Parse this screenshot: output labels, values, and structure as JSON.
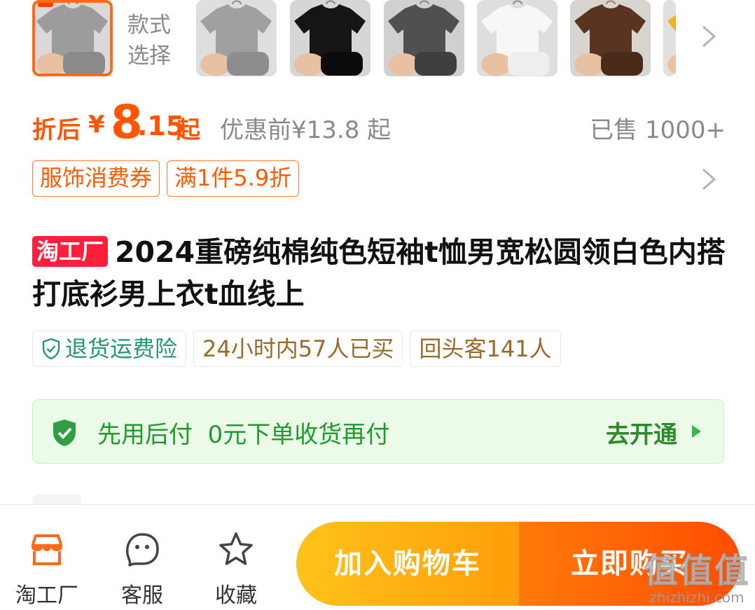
{
  "styles": {
    "label": "款式\n选择",
    "thumbnails": [
      {
        "color": "#9c9c9c",
        "fold": "#8a8a8a",
        "bg": "#d9d9d9",
        "selected": true
      },
      {
        "color": "#a0a0a0",
        "fold": "#8d8d8d",
        "bg": "#dedede",
        "selected": false
      },
      {
        "color": "#151515",
        "fold": "#0c0c0c",
        "bg": "#d6d6d6",
        "selected": false
      },
      {
        "color": "#505050",
        "fold": "#3f3f3f",
        "bg": "#d0d0d0",
        "selected": false
      },
      {
        "color": "#f7f7f7",
        "fold": "#eeeeee",
        "bg": "#dedede",
        "selected": false
      },
      {
        "color": "#5a3420",
        "fold": "#4a2a18",
        "bg": "#d8d4d0",
        "selected": false
      },
      {
        "color": "#f2b21c",
        "fold": "#e5a010",
        "bg": "#e0e0e0",
        "selected": false
      }
    ]
  },
  "price": {
    "after_label": "折后",
    "currency": "¥",
    "integer": "8",
    "decimal": ".15",
    "suffix": "起",
    "before": "优惠前¥13.8 起",
    "sold": "已售 1000+"
  },
  "coupons": [
    "服饰消费券",
    "满1件5.9折"
  ],
  "product": {
    "tag": "淘工厂",
    "title": "2024重磅纯棉纯色短袖t恤男宽松圆领白色内搭打底衫男上衣t血线上"
  },
  "badges": {
    "return_insurance": "退货运费险",
    "bought_24h": "24小时内57人已买",
    "repeat_buyers": "回头客141人"
  },
  "pay_later": {
    "text": "先用后付  0元下单收货再付",
    "action": "去开通"
  },
  "bottom_bar": {
    "shop": "淘工厂",
    "service": "客服",
    "favorite": "收藏",
    "add_to_cart": "加入购物车",
    "buy_now": "立即购买"
  },
  "watermark": {
    "brand": "值值值",
    "url": "zhizhizhi.com"
  },
  "colors": {
    "accent": "#ff5500",
    "green": "#1e9a2e",
    "tag_red": "#ff1f3a"
  }
}
